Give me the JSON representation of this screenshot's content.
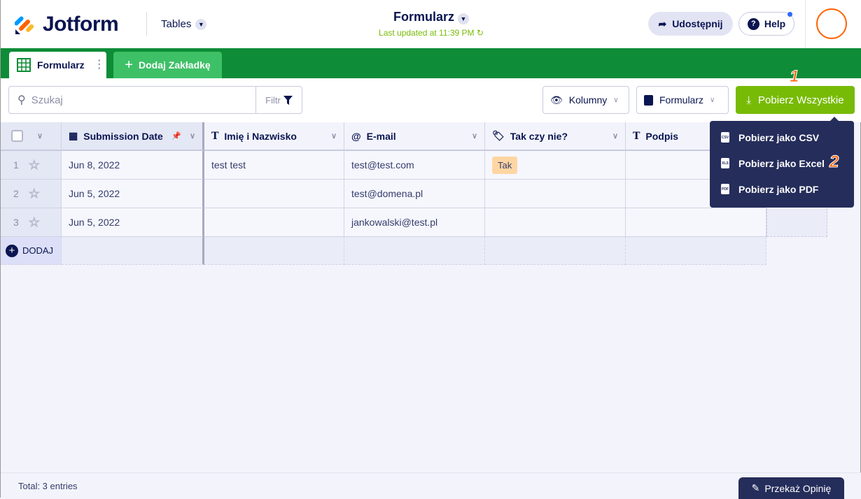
{
  "header": {
    "brand": "Jotform",
    "tables_label": "Tables",
    "title": "Formularz",
    "last_updated": "Last updated at 11:39 PM",
    "share_label": "Udostępnij",
    "help_label": "Help"
  },
  "tabs": [
    {
      "label": "Formularz",
      "active": true
    },
    {
      "label": "Dodaj Zakładkę"
    }
  ],
  "toolbar": {
    "search_placeholder": "Szukaj",
    "filter_label": "Filtr",
    "columns_label": "Kolumny",
    "form_label": "Formularz",
    "download_all_label": "Pobierz Wszystkie"
  },
  "download_menu": [
    "Pobierz jako CSV",
    "Pobierz jako Excel",
    "Pobierz jako PDF"
  ],
  "annotations": [
    "1",
    "2"
  ],
  "columns": [
    "Submission Date",
    "Imię i Nazwisko",
    "E-mail",
    "Tak czy nie?",
    "Podpis"
  ],
  "rows": [
    {
      "n": "1",
      "date": "Jun 8, 2022",
      "name": "test test",
      "email": "test@test.com",
      "yesno": "Tak",
      "sig": ""
    },
    {
      "n": "2",
      "date": "Jun 5, 2022",
      "name": "",
      "email": "test@domena.pl",
      "yesno": "",
      "sig": ""
    },
    {
      "n": "3",
      "date": "Jun 5, 2022",
      "name": "",
      "email": "jankowalski@test.pl",
      "yesno": "",
      "sig": ""
    }
  ],
  "add_row_label": "DODAJ",
  "footer": {
    "total": "Total: 3 entries",
    "feedback_label": "Przekaż Opinię"
  },
  "colors": {
    "green_header": "#0e8c37",
    "download_button": "#78bb07",
    "menu_bg": "#252d5b",
    "annotation": "#ff6100"
  }
}
